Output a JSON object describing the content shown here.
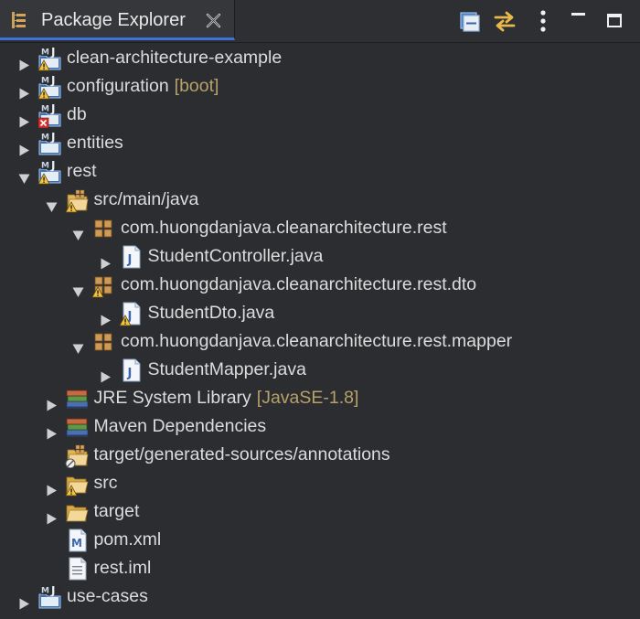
{
  "view": {
    "title": "Package Explorer",
    "accent": "#3b74d9"
  },
  "header_actions": [
    {
      "name": "collapse-all-icon"
    },
    {
      "name": "link-with-editor-icon"
    },
    {
      "name": "view-menu-icon"
    },
    {
      "name": "minimize-icon"
    },
    {
      "name": "maximize-icon"
    }
  ],
  "tree": [
    {
      "label": "clean-architecture-example",
      "deco": "",
      "depth": 0,
      "arrow": "collapsed",
      "icon": "maven-project-warning-icon"
    },
    {
      "label": "configuration",
      "deco": "[boot]",
      "depth": 0,
      "arrow": "collapsed",
      "icon": "maven-project-warning-icon"
    },
    {
      "label": "db",
      "deco": "",
      "depth": 0,
      "arrow": "collapsed",
      "icon": "maven-project-error-icon"
    },
    {
      "label": "entities",
      "deco": "",
      "depth": 0,
      "arrow": "collapsed",
      "icon": "maven-project-icon"
    },
    {
      "label": "rest",
      "deco": "",
      "depth": 0,
      "arrow": "expanded",
      "icon": "maven-project-warning-icon"
    },
    {
      "label": "src/main/java",
      "deco": "",
      "depth": 1,
      "arrow": "expanded",
      "icon": "source-folder-warning-icon"
    },
    {
      "label": "com.huongdanjava.cleanarchitecture.rest",
      "deco": "",
      "depth": 2,
      "arrow": "expanded",
      "icon": "package-icon"
    },
    {
      "label": "StudentController.java",
      "deco": "",
      "depth": 3,
      "arrow": "collapsed",
      "icon": "java-file-icon"
    },
    {
      "label": "com.huongdanjava.cleanarchitecture.rest.dto",
      "deco": "",
      "depth": 2,
      "arrow": "expanded",
      "icon": "package-warning-icon"
    },
    {
      "label": "StudentDto.java",
      "deco": "",
      "depth": 3,
      "arrow": "collapsed",
      "icon": "java-file-warning-icon"
    },
    {
      "label": "com.huongdanjava.cleanarchitecture.rest.mapper",
      "deco": "",
      "depth": 2,
      "arrow": "expanded",
      "icon": "package-icon"
    },
    {
      "label": "StudentMapper.java",
      "deco": "",
      "depth": 3,
      "arrow": "collapsed",
      "icon": "java-file-icon"
    },
    {
      "label": "JRE System Library",
      "deco": "[JavaSE-1.8]",
      "depth": 1,
      "arrow": "collapsed",
      "icon": "library-icon"
    },
    {
      "label": "Maven Dependencies",
      "deco": "",
      "depth": 1,
      "arrow": "collapsed",
      "icon": "library-icon"
    },
    {
      "label": "target/generated-sources/annotations",
      "deco": "",
      "depth": 1,
      "arrow": "none",
      "icon": "source-folder-ignored-icon"
    },
    {
      "label": "src",
      "deco": "",
      "depth": 1,
      "arrow": "collapsed",
      "icon": "folder-warning-icon"
    },
    {
      "label": "target",
      "deco": "",
      "depth": 1,
      "arrow": "collapsed",
      "icon": "folder-icon"
    },
    {
      "label": "pom.xml",
      "deco": "",
      "depth": 1,
      "arrow": "none",
      "icon": "maven-pom-icon"
    },
    {
      "label": "rest.iml",
      "deco": "",
      "depth": 1,
      "arrow": "none",
      "icon": "text-file-icon"
    },
    {
      "label": "use-cases",
      "deco": "",
      "depth": 0,
      "arrow": "collapsed",
      "icon": "maven-project-icon"
    }
  ]
}
